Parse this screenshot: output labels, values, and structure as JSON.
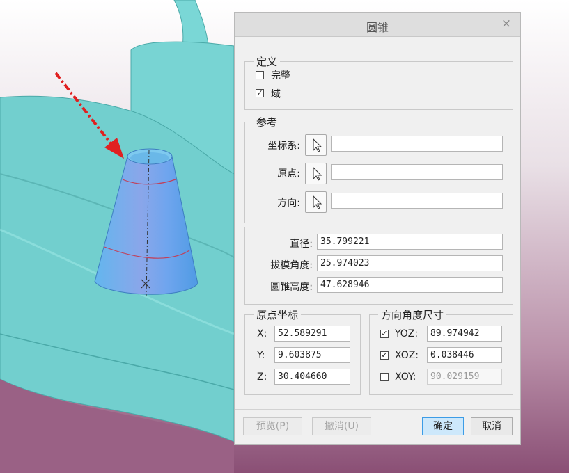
{
  "dialog": {
    "title": "圆锥",
    "close_symbol": "×",
    "definition": {
      "legend": "定义",
      "options": [
        {
          "label": "完整",
          "checked": false
        },
        {
          "label": "域",
          "checked": true
        }
      ]
    },
    "reference": {
      "legend": "参考",
      "rows": [
        {
          "label": "坐标系:",
          "value": ""
        },
        {
          "label": "原点:",
          "value": ""
        },
        {
          "label": "方向:",
          "value": ""
        }
      ]
    },
    "params": [
      {
        "label": "直径:",
        "value": "35.799221"
      },
      {
        "label": "拔模角度:",
        "value": "25.974023"
      },
      {
        "label": "圆锥高度:",
        "value": "47.628946"
      }
    ],
    "origin_coords": {
      "legend": "原点坐标",
      "rows": [
        {
          "label": "X:",
          "value": "52.589291"
        },
        {
          "label": "Y:",
          "value": "9.603875"
        },
        {
          "label": "Z:",
          "value": "30.404660"
        }
      ]
    },
    "direction_angles": {
      "legend": "方向角度尺寸",
      "rows": [
        {
          "label": "YOZ:",
          "value": "89.974942",
          "checked": true
        },
        {
          "label": "XOZ:",
          "value": "0.038446",
          "checked": true
        },
        {
          "label": "XOY:",
          "value": "90.029159",
          "checked": false
        }
      ]
    },
    "buttons": {
      "preview": "预览(P)",
      "undo": "撤消(U)",
      "ok": "确定",
      "cancel": "取消"
    }
  },
  "colors": {
    "background_top": "#ffffff",
    "background_bottom": "#8a4f75",
    "part_cyan": "#6fd0cf",
    "cone_blue": "#5fa8e6",
    "arrow_red": "#e02020",
    "accent_button": "#cde8fb"
  },
  "icons": {
    "selector": "arrow-cursor-icon",
    "close": "close-icon"
  }
}
